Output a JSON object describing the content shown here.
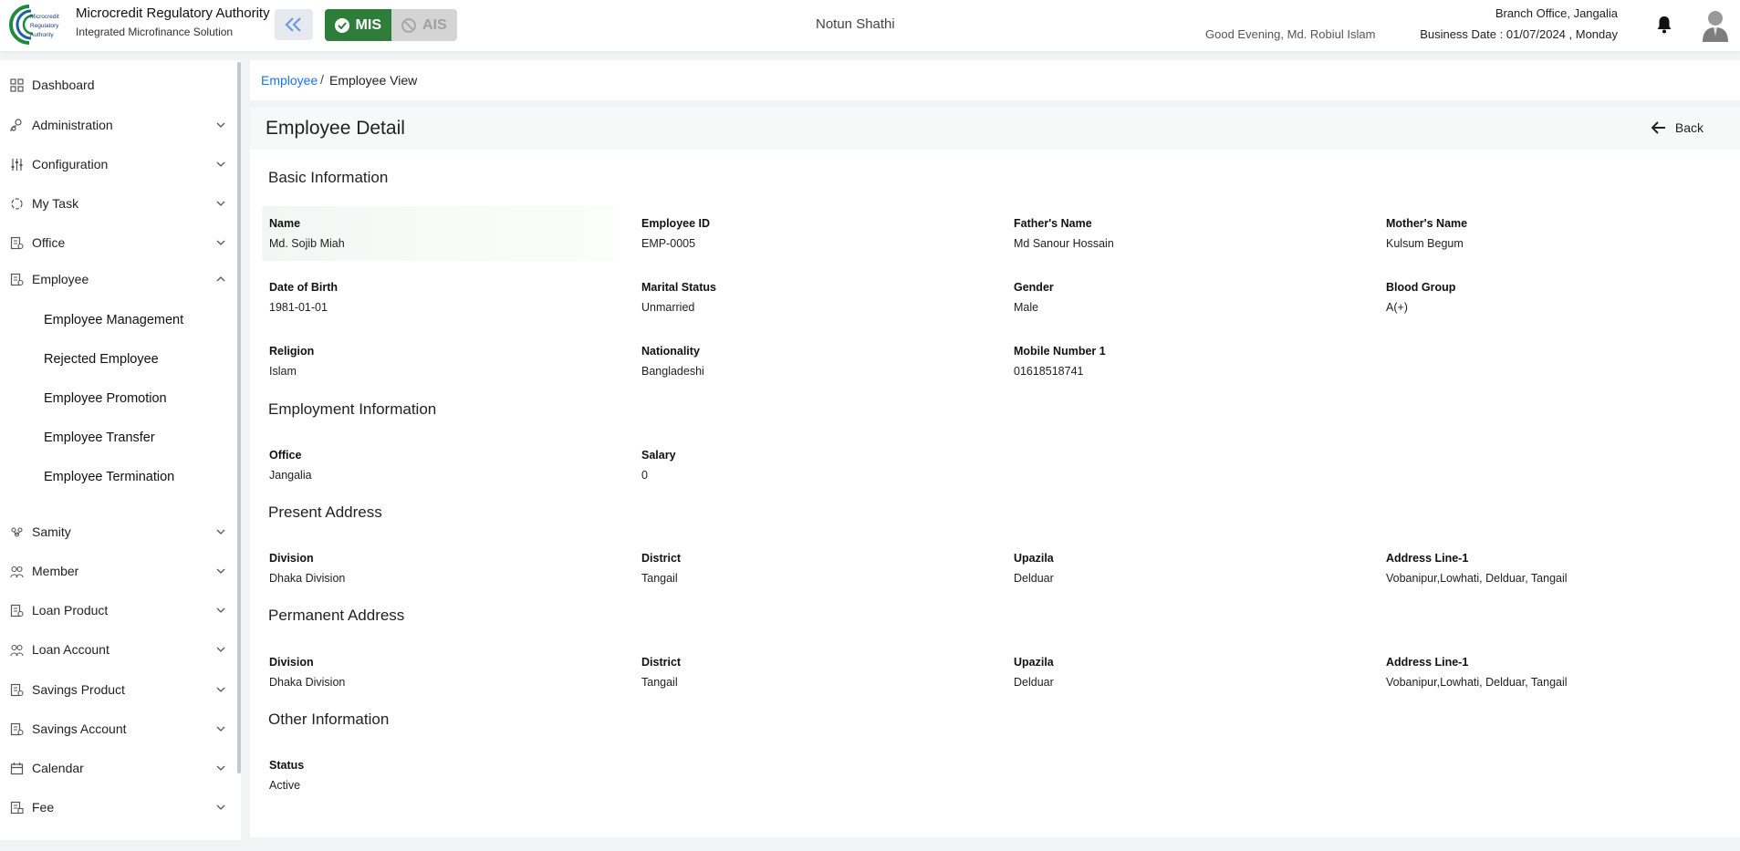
{
  "header": {
    "brand_title": "Microcredit Regulatory Authority",
    "brand_subtitle": "Integrated Microfinance Solution",
    "logo_text": [
      "Microcredit",
      "Regulatory",
      "Authority"
    ],
    "modes": [
      {
        "label": "MIS",
        "active": true
      },
      {
        "label": "AIS",
        "active": false
      }
    ],
    "org_name": "Notun Shathi",
    "greeting": "Good Evening, Md. Robiul Islam",
    "branch": "Branch Office, Jangalia",
    "business_date": "Business Date : 01/07/2024 , Monday",
    "accent_color": "#2f7d3a",
    "link_color": "#1a73e8"
  },
  "sidebar": {
    "items": [
      {
        "label": "Dashboard",
        "icon": "dashboard-icon"
      },
      {
        "label": "Administration",
        "icon": "admin-icon"
      },
      {
        "label": "Configuration",
        "icon": "sliders-icon"
      },
      {
        "label": "My Task",
        "icon": "task-icon"
      },
      {
        "label": "Office",
        "icon": "office-icon"
      },
      {
        "label": "Employee",
        "icon": "employee-icon",
        "expanded": true
      },
      {
        "label": "Samity",
        "icon": "samity-icon"
      },
      {
        "label": "Member",
        "icon": "member-icon"
      },
      {
        "label": "Loan Product",
        "icon": "loan-product-icon"
      },
      {
        "label": "Loan Account",
        "icon": "loan-account-icon"
      },
      {
        "label": "Savings Product",
        "icon": "savings-product-icon"
      },
      {
        "label": "Savings Account",
        "icon": "savings-account-icon"
      },
      {
        "label": "Calendar",
        "icon": "calendar-icon"
      },
      {
        "label": "Fee",
        "icon": "fee-icon"
      }
    ],
    "employee_sub": [
      "Employee Management",
      "Rejected Employee",
      "Employee Promotion",
      "Employee Transfer",
      "Employee Termination"
    ]
  },
  "breadcrumb": {
    "parent": "Employee",
    "separator": "/",
    "current": "Employee View"
  },
  "page": {
    "title": "Employee Detail",
    "back_label": "Back",
    "sections": {
      "basic": {
        "title": "Basic Information",
        "fields": [
          {
            "label": "Name",
            "value": "Md. Sojib Miah"
          },
          {
            "label": "Employee ID",
            "value": "EMP-0005"
          },
          {
            "label": "Father's Name",
            "value": "Md Sanour Hossain"
          },
          {
            "label": "Mother's Name",
            "value": "Kulsum Begum"
          },
          {
            "label": "Date of Birth",
            "value": "1981-01-01"
          },
          {
            "label": "Marital Status",
            "value": "Unmarried"
          },
          {
            "label": "Gender",
            "value": "Male"
          },
          {
            "label": "Blood Group",
            "value": "A(+)"
          },
          {
            "label": "Religion",
            "value": "Islam"
          },
          {
            "label": "Nationality",
            "value": "Bangladeshi"
          },
          {
            "label": "Mobile Number 1",
            "value": "01618518741"
          }
        ]
      },
      "employment": {
        "title": "Employment Information",
        "fields": [
          {
            "label": "Office",
            "value": "Jangalia"
          },
          {
            "label": "Salary",
            "value": "0"
          }
        ]
      },
      "present": {
        "title": "Present Address",
        "fields": [
          {
            "label": "Division",
            "value": "Dhaka Division"
          },
          {
            "label": "District",
            "value": "Tangail"
          },
          {
            "label": "Upazila",
            "value": "Delduar"
          },
          {
            "label": "Address Line-1",
            "value": "Vobanipur,Lowhati, Delduar, Tangail"
          }
        ]
      },
      "permanent": {
        "title": "Permanent Address",
        "fields": [
          {
            "label": "Division",
            "value": "Dhaka Division"
          },
          {
            "label": "District",
            "value": "Tangail"
          },
          {
            "label": "Upazila",
            "value": "Delduar"
          },
          {
            "label": "Address Line-1",
            "value": "Vobanipur,Lowhati, Delduar, Tangail"
          }
        ]
      },
      "other": {
        "title": "Other Information",
        "fields": [
          {
            "label": "Status",
            "value": "Active"
          }
        ]
      }
    }
  }
}
